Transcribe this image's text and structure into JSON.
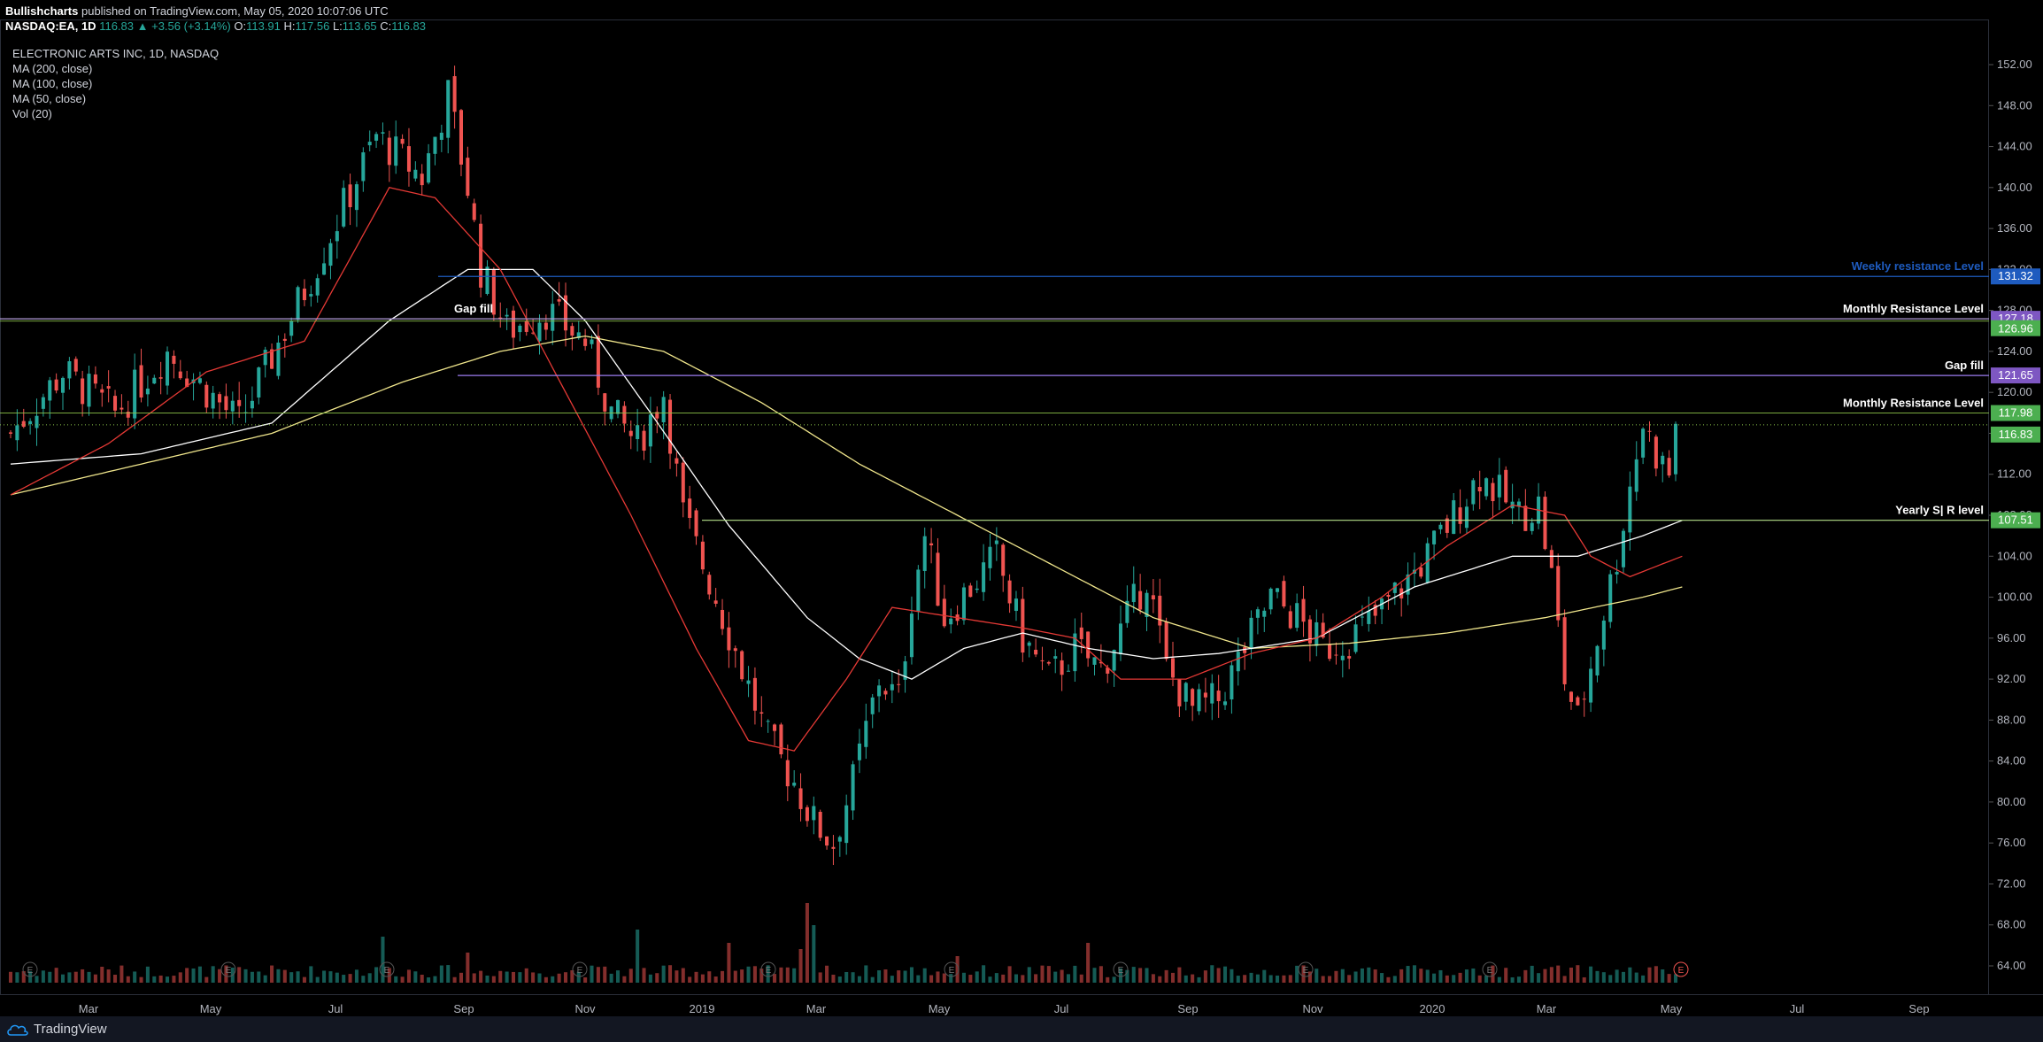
{
  "header": {
    "publisher": "Bullishcharts",
    "published_text": "published on TradingView.com, May 05, 2020 10:07:06 UTC",
    "symbol": "NASDAQ:EA, 1D",
    "last": "116.83",
    "change": "▲ +3.56 (+3.14%)",
    "o_label": "O:",
    "o": "113.91",
    "h_label": "H:",
    "h": "117.56",
    "l_label": "L:",
    "l": "113.65",
    "c_label": "C:",
    "c": "116.83"
  },
  "legend": {
    "title": "ELECTRONIC ARTS INC, 1D, NASDAQ",
    "items": [
      "MA (200, close)",
      "MA (100, close)",
      "MA (50, close)",
      "Vol (20)"
    ]
  },
  "footer": {
    "brand": "TradingView"
  },
  "colors": {
    "up": "#26a69a",
    "down": "#ef5350",
    "background": "#000000",
    "ma200": "#f0e68c",
    "ma100": "#ffffff",
    "ma50": "#e53935",
    "weekly": "#1e5bbf",
    "monthly": "#9c7cf0",
    "gapfill": "#9c7cf0",
    "yearly": "#b5e08a",
    "last": "#8bc34a"
  },
  "chart_data": {
    "type": "candlestick",
    "y_range": [
      62.0,
      154.0
    ],
    "y_ticks": [
      "152.00",
      "148.00",
      "144.00",
      "140.00",
      "136.00",
      "132.00",
      "128.00",
      "124.00",
      "120.00",
      "116.00",
      "112.00",
      "108.00",
      "104.00",
      "100.00",
      "96.00",
      "92.00",
      "88.00",
      "84.00",
      "80.00",
      "76.00",
      "72.00",
      "68.00",
      "64.00"
    ],
    "x_ticks": [
      "Mar",
      "May",
      "Jul",
      "Sep",
      "Nov",
      "2019",
      "Mar",
      "May",
      "Jul",
      "Sep",
      "Nov",
      "2020",
      "Mar",
      "May",
      "Jul",
      "Sep"
    ],
    "price_path": [
      [
        0,
        116
      ],
      [
        8,
        122
      ],
      [
        16,
        118
      ],
      [
        24,
        124
      ],
      [
        35,
        117
      ],
      [
        45,
        130
      ],
      [
        56,
        145
      ],
      [
        63,
        141
      ],
      [
        67,
        149
      ],
      [
        70,
        140
      ],
      [
        72,
        132
      ],
      [
        76,
        126
      ],
      [
        82,
        128
      ],
      [
        88,
        125
      ],
      [
        92,
        118
      ],
      [
        96,
        115
      ],
      [
        100,
        120
      ],
      [
        103,
        108
      ],
      [
        108,
        100
      ],
      [
        112,
        93
      ],
      [
        116,
        86
      ],
      [
        120,
        82
      ],
      [
        123,
        78
      ],
      [
        126,
        76
      ],
      [
        129,
        82
      ],
      [
        133,
        92
      ],
      [
        136,
        90
      ],
      [
        138,
        100
      ],
      [
        140,
        106
      ],
      [
        143,
        98
      ],
      [
        147,
        101
      ],
      [
        151,
        104
      ],
      [
        155,
        96
      ],
      [
        159,
        92
      ],
      [
        163,
        95
      ],
      [
        167,
        93
      ],
      [
        171,
        98
      ],
      [
        174,
        102
      ],
      [
        177,
        93
      ],
      [
        181,
        89
      ],
      [
        185,
        90
      ],
      [
        189,
        95
      ],
      [
        193,
        100
      ],
      [
        197,
        98
      ],
      [
        201,
        95
      ],
      [
        205,
        96
      ],
      [
        209,
        98
      ],
      [
        213,
        101
      ],
      [
        217,
        104
      ],
      [
        221,
        108
      ],
      [
        225,
        112
      ],
      [
        228,
        110
      ],
      [
        231,
        108
      ],
      [
        234,
        109
      ],
      [
        236,
        102
      ],
      [
        238,
        92
      ],
      [
        240,
        88
      ],
      [
        243,
        96
      ],
      [
        246,
        104
      ],
      [
        248,
        111
      ],
      [
        250,
        117
      ],
      [
        252,
        114
      ],
      [
        254,
        112
      ],
      [
        255,
        116.83
      ]
    ],
    "series": [
      {
        "name": "MA (200, close)",
        "points": [
          [
            0,
            110
          ],
          [
            20,
            113
          ],
          [
            40,
            116
          ],
          [
            60,
            121
          ],
          [
            75,
            124
          ],
          [
            88,
            125.5
          ],
          [
            100,
            124
          ],
          [
            115,
            119
          ],
          [
            130,
            113
          ],
          [
            145,
            108
          ],
          [
            160,
            103
          ],
          [
            175,
            98
          ],
          [
            190,
            95
          ],
          [
            205,
            95.5
          ],
          [
            220,
            96.5
          ],
          [
            235,
            98
          ],
          [
            250,
            100
          ],
          [
            256,
            101
          ]
        ]
      },
      {
        "name": "MA (100, close)",
        "points": [
          [
            0,
            113
          ],
          [
            20,
            114
          ],
          [
            40,
            117
          ],
          [
            58,
            127
          ],
          [
            70,
            132
          ],
          [
            80,
            132
          ],
          [
            88,
            127
          ],
          [
            98,
            118
          ],
          [
            110,
            107
          ],
          [
            122,
            98
          ],
          [
            130,
            94
          ],
          [
            138,
            92
          ],
          [
            146,
            95
          ],
          [
            155,
            96.5
          ],
          [
            165,
            95
          ],
          [
            175,
            94
          ],
          [
            185,
            94.5
          ],
          [
            200,
            96
          ],
          [
            215,
            101
          ],
          [
            230,
            104
          ],
          [
            240,
            104
          ],
          [
            250,
            106
          ],
          [
            256,
            107.5
          ]
        ]
      },
      {
        "name": "MA (50, close)",
        "points": [
          [
            0,
            110
          ],
          [
            15,
            115
          ],
          [
            30,
            122
          ],
          [
            45,
            125
          ],
          [
            58,
            140
          ],
          [
            65,
            139
          ],
          [
            75,
            132
          ],
          [
            85,
            120
          ],
          [
            95,
            108
          ],
          [
            105,
            95
          ],
          [
            113,
            86
          ],
          [
            120,
            85
          ],
          [
            128,
            92
          ],
          [
            135,
            99
          ],
          [
            145,
            98
          ],
          [
            155,
            97
          ],
          [
            163,
            96
          ],
          [
            170,
            92
          ],
          [
            180,
            92
          ],
          [
            190,
            94.5
          ],
          [
            200,
            96
          ],
          [
            210,
            100
          ],
          [
            220,
            105
          ],
          [
            230,
            109
          ],
          [
            238,
            108
          ],
          [
            242,
            104
          ],
          [
            248,
            102
          ],
          [
            256,
            104
          ]
        ]
      }
    ],
    "annotations": [
      {
        "label": "Weekly resistance Level",
        "value": 131.32,
        "value_label": "131.32"
      },
      {
        "label": "Monthly Resistance Level",
        "value": 127.18,
        "value_label": "127.18"
      },
      {
        "label": "Gap fill",
        "value": 121.65,
        "value_label": "121.65"
      },
      {
        "label": "Monthly Resistance Level",
        "value": 117.98,
        "value_label": "117.98"
      },
      {
        "label": "Yearly  S| R level",
        "value": 107.51,
        "value_label": "107.51"
      },
      {
        "label": "Gap fill",
        "value": 126.96,
        "value_label": "126.96"
      }
    ],
    "last_value_label": "116.83",
    "earnings_marker": "E"
  }
}
